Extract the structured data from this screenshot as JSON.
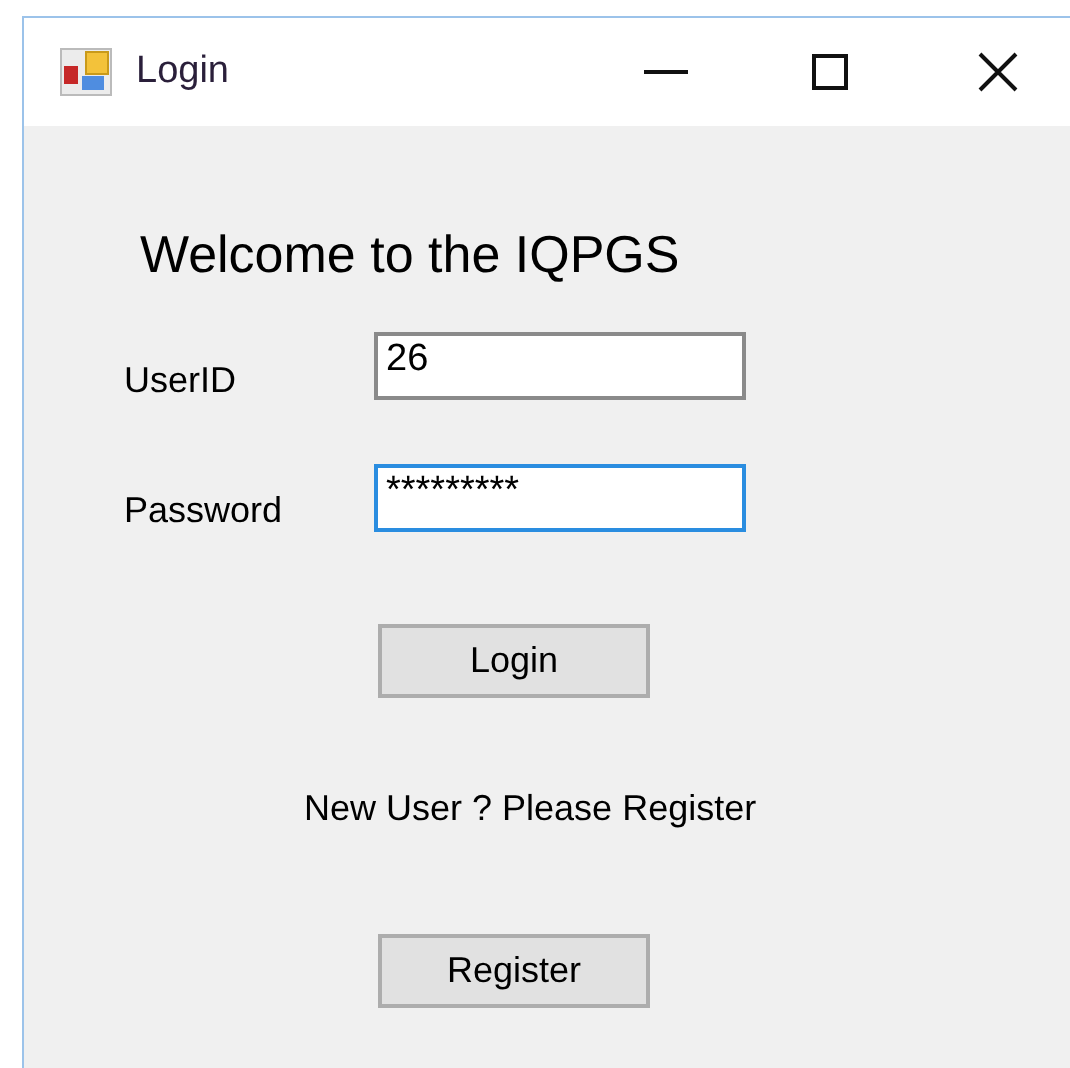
{
  "window": {
    "title": "Login"
  },
  "heading": "Welcome to the IQPGS",
  "fields": [
    {
      "label": "UserID",
      "value": "26",
      "focused": false
    },
    {
      "label": "Password",
      "value": "*********",
      "focused": true
    }
  ],
  "login_button": "Login",
  "register_prompt": "New User ? Please Register",
  "register_button": "Register"
}
